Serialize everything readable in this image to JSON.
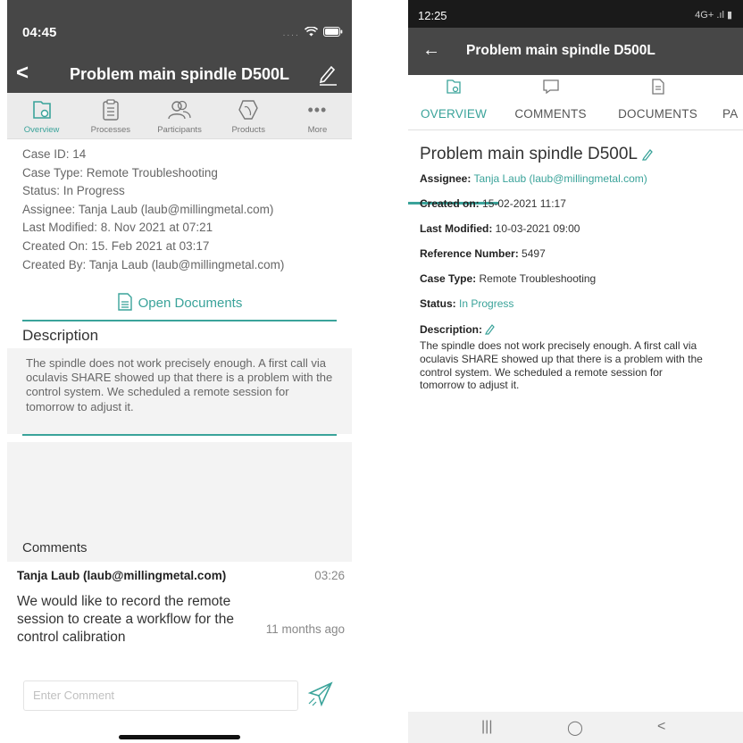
{
  "left": {
    "status_time": "04:45",
    "header": {
      "back_icon": "chevron-left-icon",
      "title": "Problem main spindle D500L",
      "edit_icon": "pencil-icon"
    },
    "tabs": [
      {
        "label": "Overview",
        "icon": "overview-icon",
        "active": true
      },
      {
        "label": "Processes",
        "icon": "clipboard-icon",
        "active": false
      },
      {
        "label": "Participants",
        "icon": "users-icon",
        "active": false
      },
      {
        "label": "Products",
        "icon": "products-icon",
        "active": false
      },
      {
        "label": "More",
        "icon": "more-icon",
        "active": false
      }
    ],
    "info": [
      "Case ID: 14",
      "Case Type: Remote Troubleshooting",
      "Status: In Progress",
      "Assignee: Tanja Laub (laub@millingmetal.com)",
      "Last Modified: 8. Nov 2021 at 07:21",
      "Created On: 15. Feb 2021 at 03:17",
      "Created By: Tanja Laub (laub@millingmetal.com)"
    ],
    "open_documents": "Open Documents",
    "description_heading": "Description",
    "description_text": "The spindle does not work precisely enough. A first call via oculavis SHARE showed up that there is a problem with the control system. We scheduled a remote session for tomorrow to adjust it.",
    "comments_heading": "Comments",
    "comment": {
      "author": "Tanja Laub (laub@millingmetal.com)",
      "time": "03:26",
      "text": "We would like to record the remote session to create a workflow for the control calibration",
      "ago": "11 months ago"
    },
    "comment_placeholder": "Enter Comment"
  },
  "right": {
    "status_time": "12:25",
    "status_right": "4G+ .ıl ▮",
    "header": {
      "back_icon": "arrow-left-icon",
      "title": "Problem main spindle D500L"
    },
    "tabs": [
      {
        "label": "OVERVIEW",
        "icon": "overview-icon",
        "active": true
      },
      {
        "label": "COMMENTS",
        "icon": "comment-icon",
        "active": false
      },
      {
        "label": "DOCUMENTS",
        "icon": "document-icon",
        "active": false
      },
      {
        "label": "PA",
        "icon": "",
        "active": false
      }
    ],
    "title": "Problem main spindle D500L",
    "assignee_label": "Assignee:",
    "assignee_value": "Tanja Laub (laub@millingmetal.com)",
    "created_label": "Created on:",
    "created_value": "15-02-2021 11:17",
    "modified_label": "Last Modified:",
    "modified_value": "10-03-2021 09:00",
    "reference_label": "Reference Number:",
    "reference_value": "5497",
    "casetype_label": "Case Type:",
    "casetype_value": "Remote Troubleshooting",
    "status_label": "Status:",
    "status_value": "In Progress",
    "description_label": "Description:",
    "description_text": "The spindle does not work precisely enough. A first call via oculavis SHARE showed up that there is a problem with the control system. We scheduled a remote session for tomorrow to adjust it.",
    "nav": {
      "recents": "|||",
      "home": "◯",
      "back": "<"
    }
  },
  "colors": {
    "accent": "#3aa39a",
    "header": "#474747",
    "tab_bg": "#ebebeb"
  }
}
